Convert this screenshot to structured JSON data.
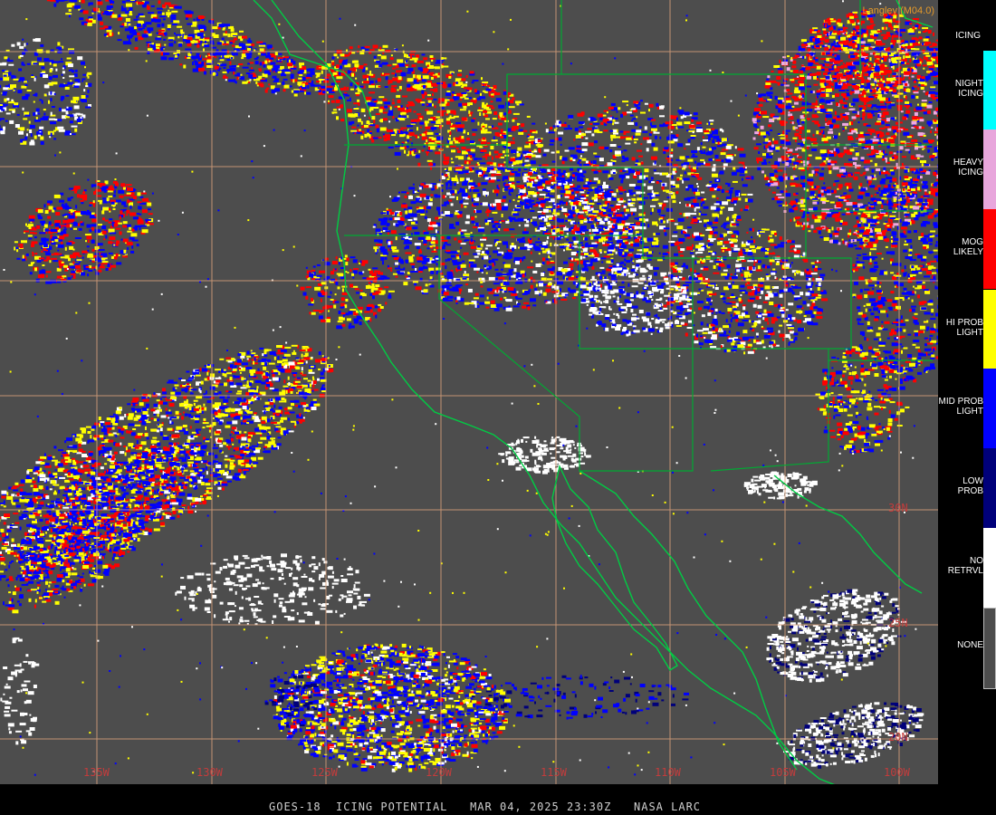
{
  "credit": "Langley (M04.0)",
  "footer": "GOES-18  ICING POTENTIAL   MAR 04, 2025 23:30Z   NASA LARC",
  "lon_labels": [
    "135W",
    "130W",
    "125W",
    "120W",
    "115W",
    "110W",
    "105W",
    "100W"
  ],
  "lat_labels": [
    "30N",
    "25N",
    "20N"
  ],
  "legend": {
    "title": "ICING",
    "items": [
      {
        "label": "NIGHT\nICING",
        "color": "#00ffff"
      },
      {
        "label": "HEAVY\nICING",
        "color": "#e8a6dc"
      },
      {
        "label": "MOG\nLIKELY",
        "color": "#ff0000"
      },
      {
        "label": "HI PROB\nLIGHT",
        "color": "#ffff00"
      },
      {
        "label": "MID PROB\nLIGHT",
        "color": "#0000ff"
      },
      {
        "label": "LOW\nPROB",
        "color": "#00007a"
      },
      {
        "label": "NO\nRETRVL",
        "color": "#ffffff"
      },
      {
        "label": "NONE",
        "color": "#4d4d4d"
      }
    ]
  },
  "colors": {
    "background": "#4d4d4d",
    "grid": "#d9a07a",
    "coast": "#00cc44",
    "border": "#00aa33"
  }
}
